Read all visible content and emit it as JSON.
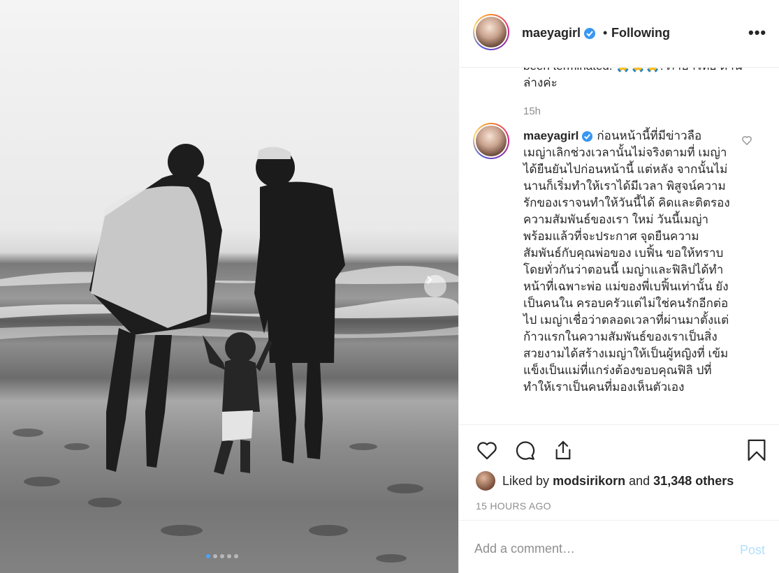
{
  "post": {
    "username": "maeyagirl",
    "separator": "•",
    "follow_status": "Following",
    "more": "•••"
  },
  "comments": {
    "previous_text": "been terminated. 🙏🙏🙏. ภาษาไทย ด้านล่างค่ะ",
    "previous_time": "15h",
    "caption_user": "maeyagirl",
    "caption_text": "ก่อนหน้านี้ที่มีข่าวลือ เมญ่าเลิกช่วงเวลานั้นไม่จริงตามที่ เมญ่าได้ยืนยันไปก่อนหน้านี้ แต่หลัง จากนั้นไม่นานก็เริ่มทำให้เราได้มีเวลา พิสูจน์ความรักของเราจนทำให้วันนี้ได้ คิดและติตรองความสัมพันธ์ของเรา ใหม่ วันนี้เมญ่าพร้อมแล้วที่จะประกาศ จุดยืนความสัมพันธ์กับคุณพ่อของ เบฟิ้น ขอให้ทราบโดยทั่วกันว่าตอนนี้ เมญ่าและฟิลิปได้ทำหน้าที่เฉพาะพ่อ แม่ของพี่เบฟิ้นเท่านั้น ยังเป็นคนใน ครอบครัวแต่ไม่ใช่คนรักอีกต่อไป เมญ่าเชื่อว่าตลอดเวลาที่ผ่านมาตั้งแต่ ก้าวแรกในความสัมพันธ์ของเราเป็นสิ่ง สวยงามได้สร้างเมญ่าให้เป็นผู้หญิงที่ เข้มแข็งเป็นแม่ที่แกร่งต้องขอบคุณฟิลิ ปที่ทำให้เราเป็นคนที่มองเห็นตัวเอง"
  },
  "likes": {
    "prefix": "Liked by",
    "first_user": "modsirikorn",
    "conjunction": "and",
    "others": "31,348 others"
  },
  "timestamp": "15 HOURS AGO",
  "comment_box": {
    "placeholder": "Add a comment…",
    "post_label": "Post"
  },
  "carousel": {
    "slide_count": 5,
    "active_index": 0
  },
  "colors": {
    "verified": "#3897f0",
    "post_disabled": "#b2dffc",
    "muted": "#8e8e8e",
    "active_dot": "#4aa3ff"
  },
  "icons": [
    "verified-badge-icon",
    "more-options-icon",
    "heart-icon",
    "comment-icon",
    "share-icon",
    "bookmark-icon",
    "chevron-right-icon"
  ]
}
